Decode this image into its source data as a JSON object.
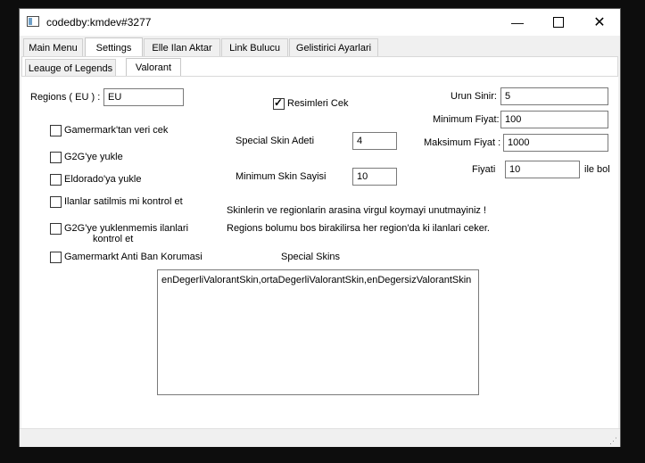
{
  "window": {
    "title": "codedby:kmdev#3277"
  },
  "main_tabs": [
    {
      "label": "Main Menu"
    },
    {
      "label": "Settings"
    },
    {
      "label": "Elle Ilan Aktar"
    },
    {
      "label": "Link Bulucu"
    },
    {
      "label": "Gelistirici Ayarlari"
    }
  ],
  "sub_tabs": [
    {
      "label": "Leauge of Legends"
    },
    {
      "label": "Valorant"
    }
  ],
  "regions": {
    "label": "Regions ( EU ) :",
    "value": "EU"
  },
  "checkboxes": [
    {
      "label": "Gamermark'tan veri cek",
      "checked": false
    },
    {
      "label": "G2G'ye yukle",
      "checked": false
    },
    {
      "label": "Eldorado'ya yukle",
      "checked": false
    },
    {
      "label": "Ilanlar satilmis mi kontrol et",
      "checked": false
    },
    {
      "label": "G2G'ye yuklenmemis ilanlari",
      "label2": "kontrol et",
      "checked": false
    },
    {
      "label": "Gamermarkt Anti Ban Korumasi",
      "checked": false
    }
  ],
  "resimleri_cek": {
    "label": "Resimleri Cek",
    "checked": true
  },
  "special_skin_adeti": {
    "label": "Special Skin Adeti",
    "value": "4"
  },
  "minimum_skin_sayisi": {
    "label": "Minimum Skin Sayisi",
    "value": "10"
  },
  "urun_sinir": {
    "label": "Urun Sinir:",
    "value": "5"
  },
  "minimum_fiyat": {
    "label": "Minimum Fiyat:",
    "value": "100"
  },
  "maksimum_fiyat": {
    "label": "Maksimum Fiyat :",
    "value": "1000"
  },
  "fiyati": {
    "label": "Fiyati",
    "value": "10",
    "suffix": "ile bol"
  },
  "notes": {
    "line1": "Skinlerin ve regionlarin arasina virgul koymayi unutmayiniz !",
    "line2": "Regions bolumu bos birakilirsa her region'da ki ilanlari ceker."
  },
  "special_skins": {
    "label": "Special Skins",
    "value": "enDegerliValorantSkin,ortaDegerliValorantSkin,enDegersizValorantSkin"
  }
}
